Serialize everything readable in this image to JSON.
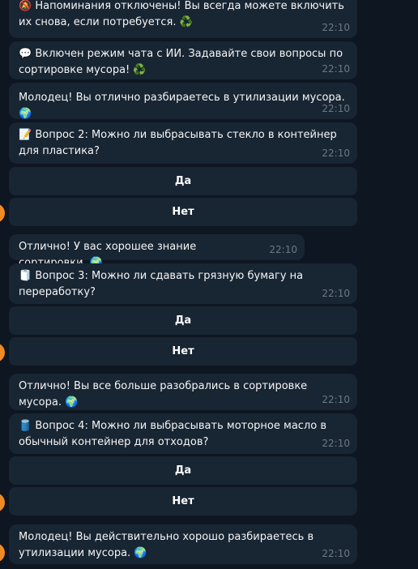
{
  "messages": [
    {
      "icon": "🔕",
      "icon_name": "muted-bell-icon",
      "text": "Напоминания отключены! Вы всегда можете включить их снова, если потребуется. ♻️",
      "time": "22:10"
    },
    {
      "icon": "💬",
      "icon_name": "speech-bubble-icon",
      "text": "Включен режим чата с ИИ. Задавайте свои вопросы по сортировке мусора! ♻️",
      "time": "22:10"
    },
    {
      "text": "Молодец! Вы отлично разбираетесь в утилизации мусора. 🌍",
      "time": "22:10"
    },
    {
      "icon": "📝",
      "icon_name": "memo-icon",
      "text": "Вопрос 2: Можно ли выбрасывать стекло в контейнер для пластика?",
      "time": "22:10"
    },
    {
      "text": "Отлично! У вас хорошее знание сортировки. 🌍",
      "time": "22:10"
    },
    {
      "icon": "🧻",
      "icon_name": "paper-roll-icon",
      "text": "Вопрос 3: Можно ли сдавать грязную бумагу на переработку?",
      "time": "22:10"
    },
    {
      "text": "Отлично! Вы все больше разобрались в сортировке мусора. 🌍",
      "time": "22:10"
    },
    {
      "icon": "🛢️",
      "icon_name": "oil-drum-icon",
      "text": "Вопрос 4: Можно ли выбрасывать моторное масло в обычный контейнер для отходов?",
      "time": "22:10"
    },
    {
      "text": "Молодец! Вы действительно хорошо разбираетесь в утилизации мусора. 🌍",
      "time": "22:10"
    }
  ],
  "keyboards": [
    {
      "yes": "Да",
      "no": "Нет"
    },
    {
      "yes": "Да",
      "no": "Нет"
    },
    {
      "yes": "Да",
      "no": "Нет"
    }
  ],
  "colors": {
    "background": "#0e1621",
    "bubble": "#182533",
    "time": "#6c7883",
    "avatar": "#f08a24"
  }
}
